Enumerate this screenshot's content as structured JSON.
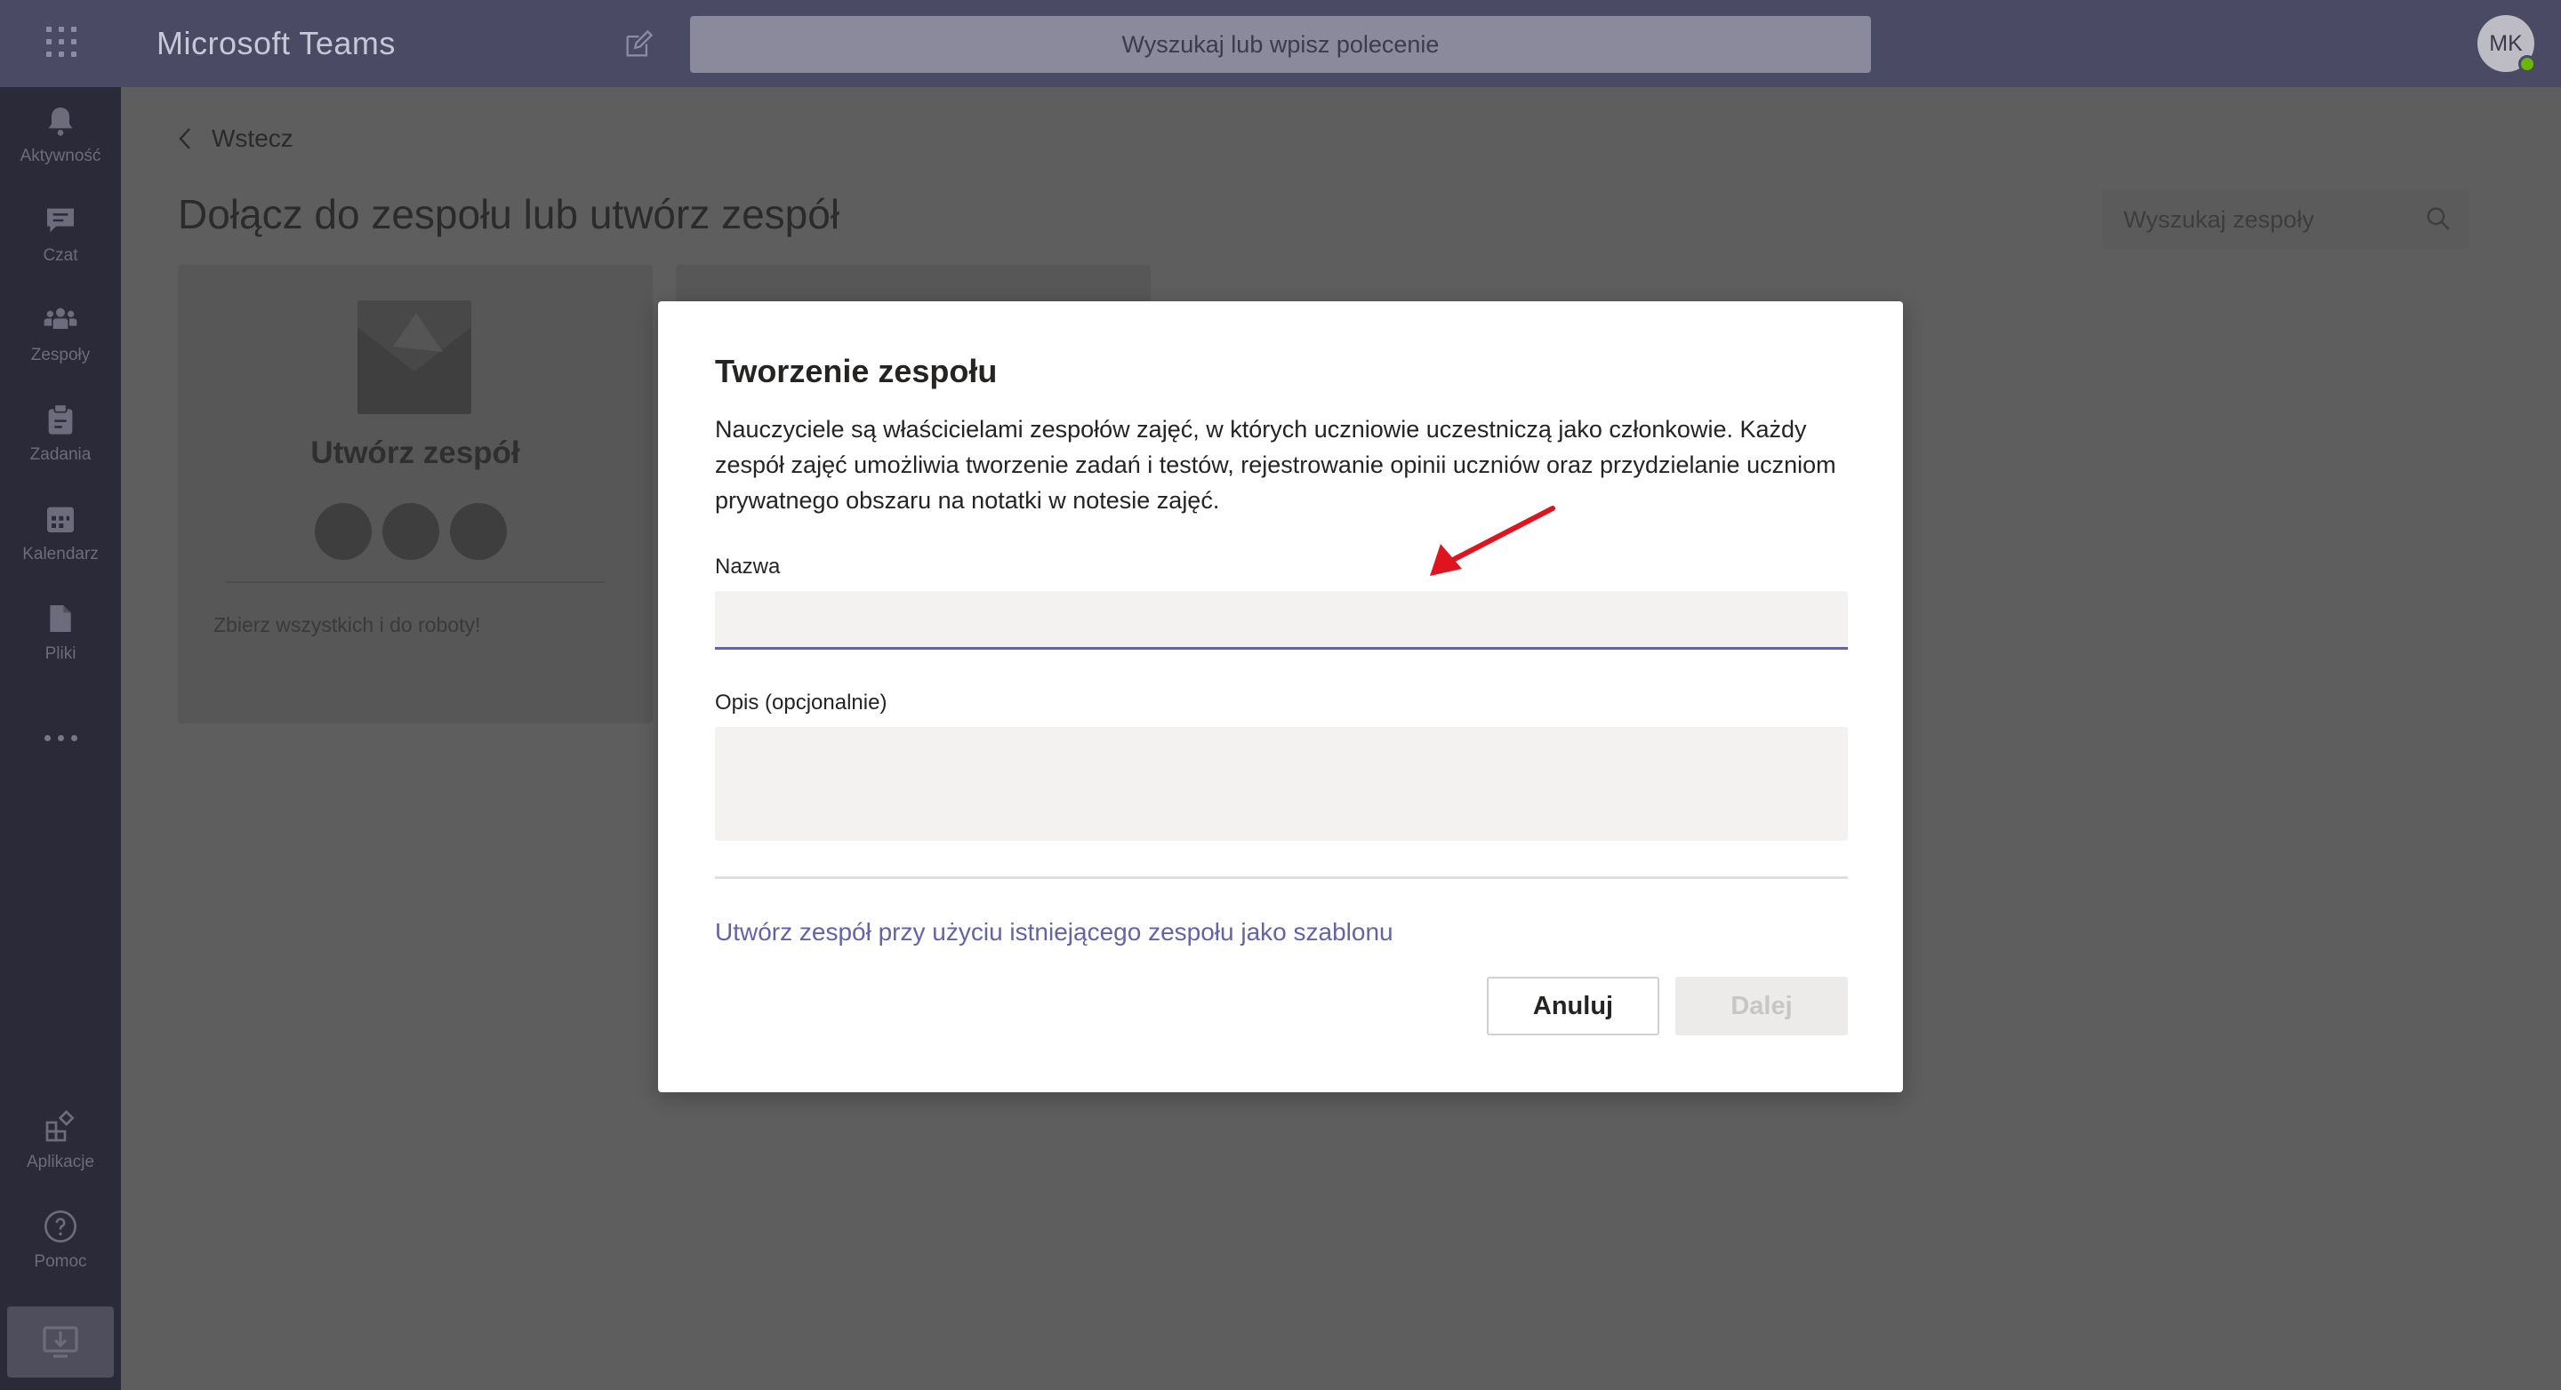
{
  "app": {
    "title": "Microsoft Teams",
    "search_placeholder": "Wyszukaj lub wpisz polecenie",
    "avatar_initials": "MK"
  },
  "rail": {
    "items": [
      {
        "label": "Aktywność",
        "icon": "bell-icon"
      },
      {
        "label": "Czat",
        "icon": "chat-icon"
      },
      {
        "label": "Zespoły",
        "icon": "teams-icon"
      },
      {
        "label": "Zadania",
        "icon": "assignments-icon"
      },
      {
        "label": "Kalendarz",
        "icon": "calendar-icon"
      },
      {
        "label": "Pliki",
        "icon": "files-icon"
      }
    ],
    "bottom": [
      {
        "label": "Aplikacje",
        "icon": "apps-icon"
      },
      {
        "label": "Pomoc",
        "icon": "help-icon"
      }
    ]
  },
  "page": {
    "back_label": "Wstecz",
    "title": "Dołącz do zespołu lub utwórz zespół",
    "team_search_placeholder": "Wyszukaj zespoły"
  },
  "card": {
    "title": "Utwórz zespół",
    "description": "Zbierz wszystkich i do roboty!"
  },
  "dialog": {
    "title": "Tworzenie zespołu",
    "description": "Nauczyciele są właścicielami zespołów zajęć, w których uczniowie uczestniczą jako członkowie. Każdy zespół zajęć umożliwia tworzenie zadań i testów, rejestrowanie opinii uczniów oraz przydzielanie uczniom prywatnego obszaru na notatki w notesie zajęć.",
    "name_label": "Nazwa",
    "name_value": "",
    "description_label": "Opis (opcjonalnie)",
    "description_value": "",
    "template_link": "Utwórz zespół przy użyciu istniejącego zespołu jako szablonu",
    "cancel_label": "Anuluj",
    "next_label": "Dalej"
  },
  "colors": {
    "accent": "#6264a7",
    "annotation_arrow": "#e0141e"
  }
}
